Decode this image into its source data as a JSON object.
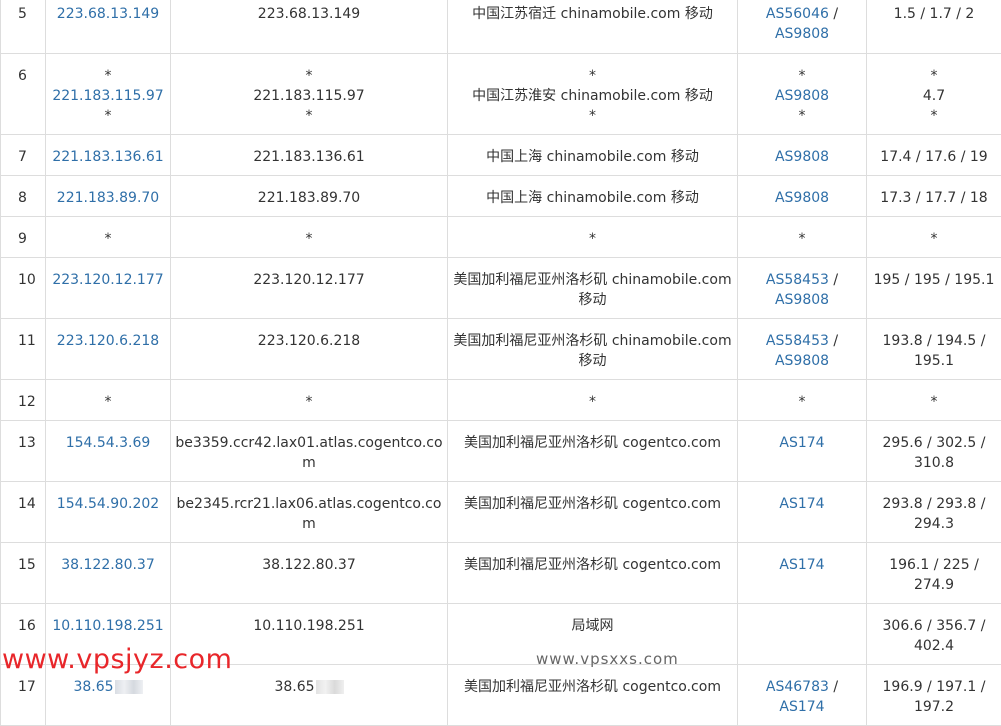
{
  "rows": [
    {
      "hop": "5",
      "ip": "223.68.13.149",
      "host": "223.68.13.149",
      "loc": "中国江苏宿迁 chinamobile.com 移动",
      "as": [
        "AS56046",
        "AS9808"
      ],
      "rtt": "1.5 / 1.7 / 2"
    },
    {
      "hop": "6",
      "ip": "221.183.115.97",
      "host": "221.183.115.97",
      "loc": "中国江苏淮安 chinamobile.com 移动",
      "as": [
        "AS9808"
      ],
      "rtt": "4.7"
    },
    {
      "hop": "7",
      "ip": "221.183.136.61",
      "host": "221.183.136.61",
      "loc": "中国上海 chinamobile.com 移动",
      "as": [
        "AS9808"
      ],
      "rtt": "17.4 / 17.6 / 19"
    },
    {
      "hop": "8",
      "ip": "221.183.89.70",
      "host": "221.183.89.70",
      "loc": "中国上海 chinamobile.com 移动",
      "as": [
        "AS9808"
      ],
      "rtt": "17.3 / 17.7 / 18"
    },
    {
      "hop": "9",
      "ip": "*",
      "host": "*",
      "loc": "*",
      "as": [
        "*"
      ],
      "rtt": "*"
    },
    {
      "hop": "10",
      "ip": "223.120.12.177",
      "host": "223.120.12.177",
      "loc": "美国加利福尼亚州洛杉矶 chinamobile.com 移动",
      "as": [
        "AS58453",
        "AS9808"
      ],
      "rtt": "195 / 195 / 195.1"
    },
    {
      "hop": "11",
      "ip": "223.120.6.218",
      "host": "223.120.6.218",
      "loc": "美国加利福尼亚州洛杉矶 chinamobile.com 移动",
      "as": [
        "AS58453",
        "AS9808"
      ],
      "rtt": "193.8 / 194.5 / 195.1"
    },
    {
      "hop": "12",
      "ip": "*",
      "host": "*",
      "loc": "*",
      "as": [
        "*"
      ],
      "rtt": "*"
    },
    {
      "hop": "13",
      "ip": "154.54.3.69",
      "host": "be3359.ccr42.lax01.atlas.cogentco.com",
      "loc": "美国加利福尼亚州洛杉矶 cogentco.com",
      "as": [
        "AS174"
      ],
      "rtt": "295.6 / 302.5 / 310.8"
    },
    {
      "hop": "14",
      "ip": "154.54.90.202",
      "host": "be2345.rcr21.lax06.atlas.cogentco.com",
      "loc": "美国加利福尼亚州洛杉矶 cogentco.com",
      "as": [
        "AS174"
      ],
      "rtt": "293.8 / 293.8 / 294.3"
    },
    {
      "hop": "15",
      "ip": "38.122.80.37",
      "host": "38.122.80.37",
      "loc": "美国加利福尼亚州洛杉矶 cogentco.com",
      "as": [
        "AS174"
      ],
      "rtt": "196.1 / 225 / 274.9"
    },
    {
      "hop": "16",
      "ip": "10.110.198.251",
      "host": "10.110.198.251",
      "loc": "局域网",
      "as": [],
      "rtt": "306.6 / 356.7 / 402.4"
    },
    {
      "hop": "17",
      "ip": "38.65",
      "host": "38.65",
      "loc": "美国加利福尼亚州洛杉矶 cogentco.com",
      "as": [
        "AS46783",
        "AS174"
      ],
      "rtt": "196.9 / 197.1 / 197.2"
    }
  ],
  "star": "*",
  "as_sep": " /",
  "watermark_red": "www.vpsjyz.com",
  "watermark_gray": "www.vpsxxs.com",
  "colors": {
    "link": "#2f6fa8",
    "border": "#dddddd",
    "text": "#333333",
    "watermark_red": "#e8262a"
  }
}
